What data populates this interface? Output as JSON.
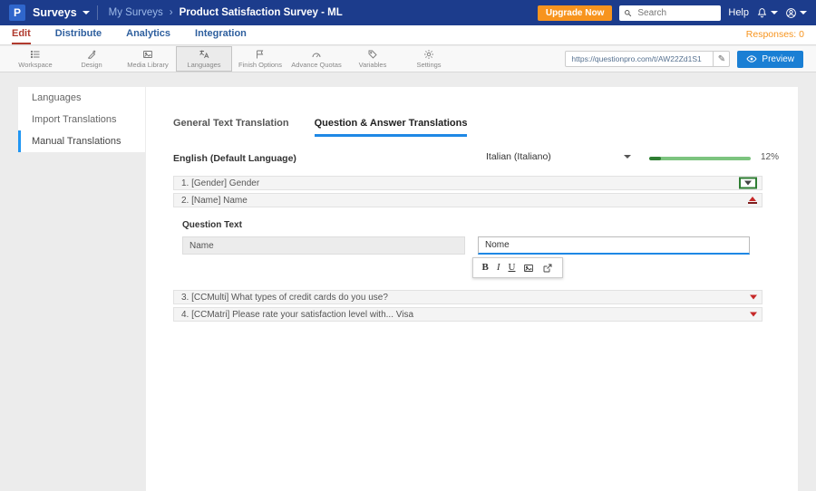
{
  "topbar": {
    "logo_letter": "P",
    "product_label": "Surveys",
    "breadcrumb_parent": "My Surveys",
    "breadcrumb_separator": "›",
    "title": "Product Satisfaction Survey - ML",
    "upgrade_label": "Upgrade Now",
    "search_placeholder": "Search",
    "help_label": "Help"
  },
  "nav": {
    "items": [
      "Edit",
      "Distribute",
      "Analytics",
      "Integration"
    ],
    "active": "Edit",
    "responses": "Responses: 0"
  },
  "toolbar": {
    "items": [
      "Workspace",
      "Design",
      "Media Library",
      "Languages",
      "Finish Options",
      "Advance Quotas",
      "Variables",
      "Settings"
    ],
    "active": "Languages",
    "url": "https://questionpro.com/t/AW22Zd1S1",
    "url_edit_glyph": "✎",
    "preview_label": "Preview"
  },
  "sidebar": {
    "items": [
      "Languages",
      "Import Translations",
      "Manual Translations"
    ],
    "active": "Manual Translations"
  },
  "main": {
    "tabs": [
      "General Text Translation",
      "Question & Answer Translations"
    ],
    "active_tab": "Question & Answer Translations",
    "source_language": "English (Default Language)",
    "target_language": "Italian (Italiano)",
    "progress_percent": "12%",
    "progress_width": "12%",
    "questions": [
      {
        "label": "1. [Gender] Gender"
      },
      {
        "label": "2. [Name] Name"
      },
      {
        "label": "3. [CCMulti] What types of credit cards do you use?"
      },
      {
        "label": "4. [CCMatri] Please rate your satisfaction level with... Visa"
      }
    ],
    "editor": {
      "field_label": "Question Text",
      "source_value": "Name",
      "target_value": "Nome",
      "format_buttons": {
        "bold": "B",
        "italic": "I",
        "underline": "U"
      }
    }
  }
}
